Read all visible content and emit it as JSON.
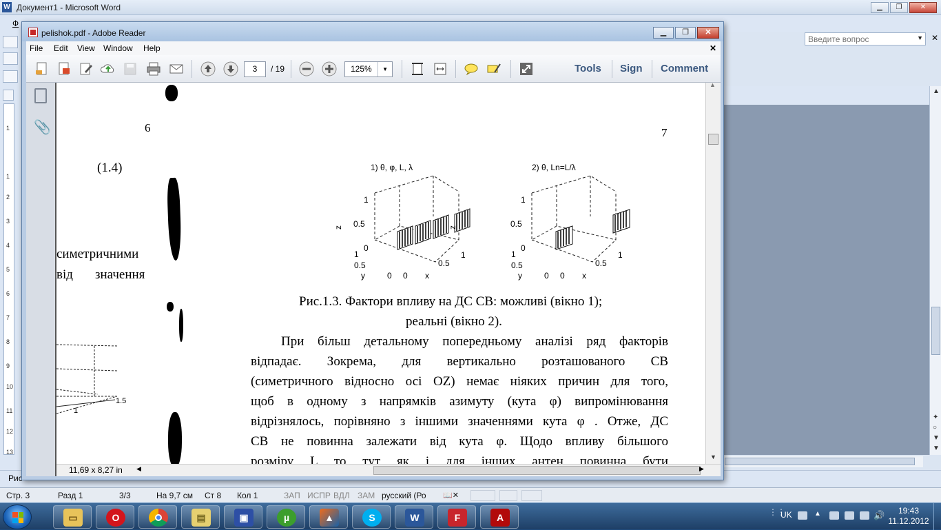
{
  "word": {
    "title": "Документ1 - Microsoft Word",
    "menu_first": "Ф",
    "ask_placeholder": "Введите вопрос",
    "drawing_label": "Рис",
    "status": {
      "page": "Стр. 3",
      "section": "Разд 1",
      "pages": "3/3",
      "at": "На 9,7 см",
      "line": "Ст 8",
      "col": "Кол 1",
      "rec": "ЗАП",
      "trk": "ИСПР",
      "ext": "ВДЛ",
      "ovr": "ЗАМ",
      "lang": "русский (Ро"
    }
  },
  "reader": {
    "title": "pelishok.pdf - Adobe Reader",
    "menu": [
      "File",
      "Edit",
      "View",
      "Window",
      "Help"
    ],
    "page_current": "3",
    "page_total": "/ 19",
    "zoom": "125%",
    "tools": "Tools",
    "sign": "Sign",
    "comment": "Comment",
    "page_size": "11,69 x 8,27 in"
  },
  "pdf": {
    "left_page_number": "6",
    "right_page_number": "7",
    "equation_number": "(1.4)",
    "left_line1": "симетричними",
    "left_line2_a": "від",
    "left_line2_b": "значення",
    "left_plot_tick_1": "1",
    "left_plot_tick_15": "1.5",
    "plot1_title": "1) θ, φ, L, λ",
    "plot2_title": "2) θ, Ln=L/λ",
    "axis_z": "z",
    "axis_y": "y",
    "axis_x": "x",
    "tick_1": "1",
    "tick_05": "0.5",
    "tick_0": "0",
    "caption_line1": "Рис.1.3. Фактори впливу на ДС СВ: можливі (вікно 1);",
    "caption_line2": "реальні (вікно 2).",
    "paragraph": [
      "При більш детальному попередньому аналізі ряд факторів",
      "відпадає.  Зокрема, для вертикально розташованого СВ",
      "(симетричного відносно осі  OZ) немає ніяких причин для того,",
      "щоб в одному з напрямків азимуту (кута φ) випромінювання",
      "відрізнялось,  порівняно з іншими значеннями кута φ . Отже, ДС",
      "СВ не повинна залежати  від кута φ. Щодо впливу більшого",
      "розміру L  то    тут    як і  для  інших  антен  повинна бути"
    ]
  },
  "taskbar": {
    "lang": "UK",
    "time": "19:43",
    "date": "11.12.2012",
    "apps": [
      "explorer-icon",
      "opera-icon",
      "chrome-icon",
      "folder-icon",
      "save-icon",
      "utorrent-icon",
      "matlab-icon",
      "skype-icon",
      "word-icon",
      "unknown-app-icon",
      "acrobat-icon"
    ]
  },
  "colors": {
    "reader_frame": "#b9cce4",
    "taskbar": "#1f4a7a",
    "accent_tools": "#3d5a80"
  }
}
